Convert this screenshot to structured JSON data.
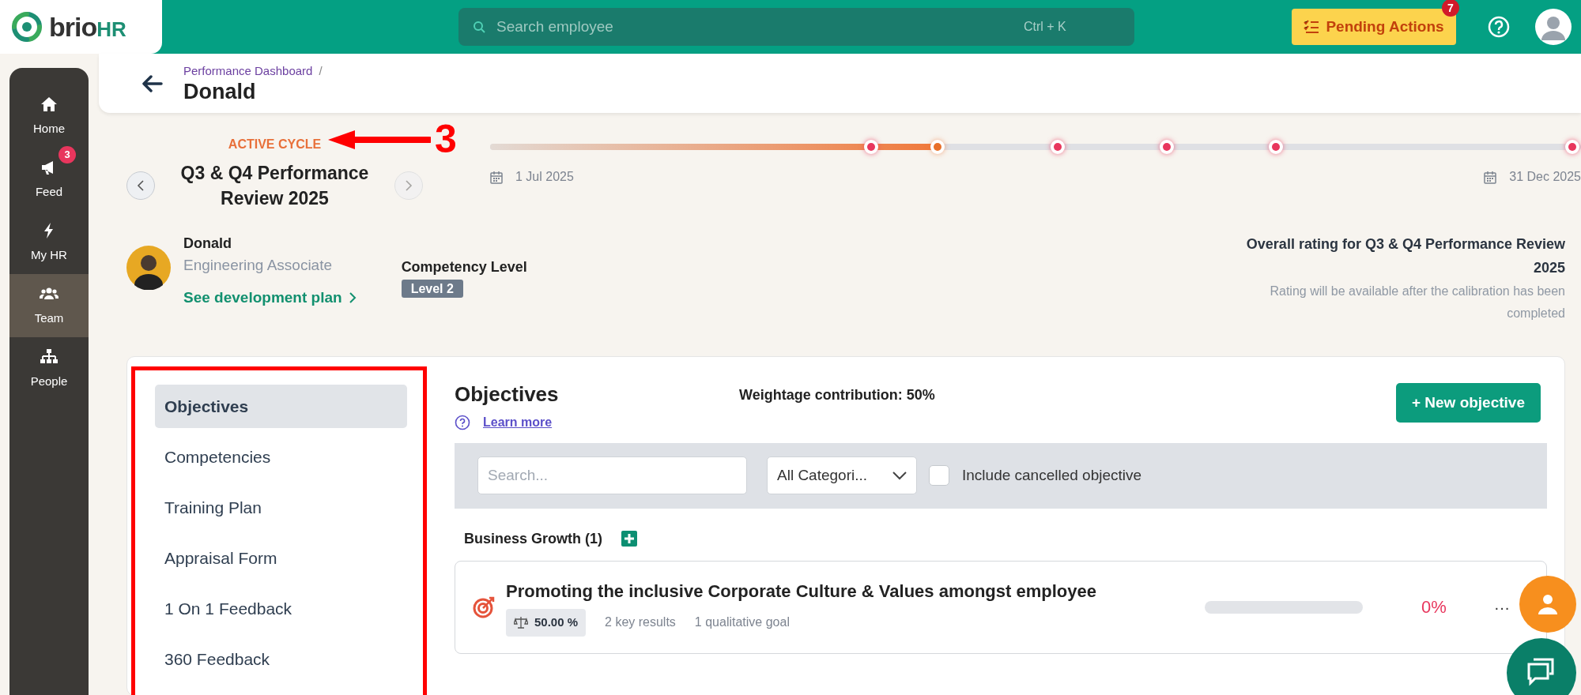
{
  "topbar": {
    "logo": {
      "name": "brio",
      "suffix": "HR"
    },
    "search": {
      "placeholder": "Search employee",
      "shortcut": "Ctrl + K"
    },
    "pending_actions": {
      "label": "Pending Actions",
      "badge": "7"
    }
  },
  "rail": {
    "items": [
      {
        "kind": "home",
        "label": "Home",
        "selected": false
      },
      {
        "kind": "feed",
        "label": "Feed",
        "badge": "3",
        "selected": false
      },
      {
        "kind": "myhr",
        "label": "My HR",
        "selected": false
      },
      {
        "kind": "team",
        "label": "Team",
        "selected": true
      },
      {
        "kind": "people",
        "label": "People",
        "selected": false
      }
    ]
  },
  "header": {
    "breadcrumb": "Performance Dashboard",
    "separator": "/",
    "title": "Donald"
  },
  "cycle": {
    "status": "ACTIVE CYCLE",
    "title": "Q3 & Q4 Performance Review 2025",
    "prev_disabled": false,
    "next_disabled": true
  },
  "annotation": {
    "label": "3"
  },
  "timeline": {
    "level": 0.41,
    "start": "1 Jul 2025",
    "end": "31 Dec 2025",
    "milestones": [
      {
        "current": false
      },
      {
        "current": true
      },
      {
        "current": false
      },
      {
        "current": false
      },
      {
        "current": false
      },
      {
        "current": false
      }
    ]
  },
  "employee": {
    "name": "Donald",
    "role": "Engineering Associate",
    "link": "See development plan"
  },
  "competency": {
    "label": "Competency Level",
    "badge": "Level 2"
  },
  "rating": {
    "title": "Overall rating for Q3 & Q4 Performance Review 2025",
    "note": "Rating will be available after the calibration has been completed"
  },
  "sections": [
    {
      "label": "Objectives",
      "selected": true
    },
    {
      "label": "Competencies",
      "selected": false
    },
    {
      "label": "Training Plan",
      "selected": false
    },
    {
      "label": "Appraisal Form",
      "selected": false
    },
    {
      "label": "1 On 1 Feedback",
      "selected": false
    },
    {
      "label": "360 Feedback",
      "selected": false
    }
  ],
  "objectives": {
    "title": "Objectives",
    "weightage": "Weightage contribution: 50%",
    "new_button": "+ New objective",
    "learn_more": "Learn more",
    "filters": {
      "search_placeholder": "Search...",
      "category": "All Categori...",
      "include_cancelled": {
        "label": "Include cancelled objective",
        "checked": false
      }
    },
    "groups": [
      {
        "name": "Business Growth (1)",
        "items": [
          {
            "title": "Promoting the inclusive Corporate Culture & Values amongst employee",
            "weight": "50.00 %",
            "key_results": "2 key results",
            "goals": "1 qualitative goal",
            "level": 0,
            "progress": "0%",
            "menu": "···"
          }
        ]
      }
    ]
  }
}
